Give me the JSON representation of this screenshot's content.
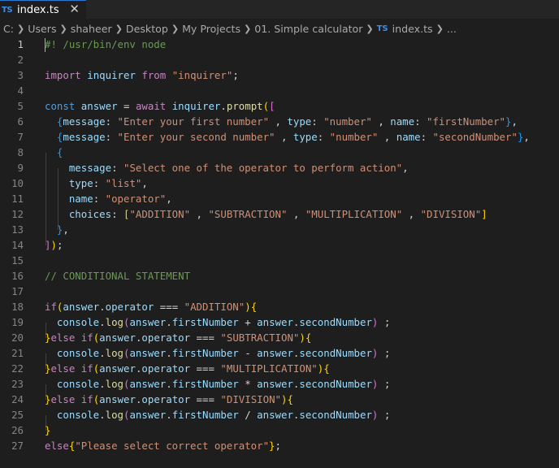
{
  "tab": {
    "badge": "TS",
    "label": "index.ts",
    "close": "✕"
  },
  "breadcrumb": {
    "items": [
      "C:",
      "Users",
      "shaheer",
      "Desktop",
      "My Projects",
      "01. Simple calculator"
    ],
    "file_badge": "TS",
    "file": "index.ts",
    "more": "..."
  },
  "editor": {
    "active_line": 1,
    "lines": [
      [
        [
          "cmt",
          "#! /usr/bin/env node"
        ]
      ],
      [],
      [
        [
          "ctl",
          "import"
        ],
        [
          "txt",
          " "
        ],
        [
          "var",
          "inquirer"
        ],
        [
          "txt",
          " "
        ],
        [
          "ctl",
          "from"
        ],
        [
          "txt",
          " "
        ],
        [
          "str",
          "\"inquirer\""
        ],
        [
          "txt",
          ";"
        ]
      ],
      [],
      [
        [
          "kw",
          "const"
        ],
        [
          "txt",
          " "
        ],
        [
          "var",
          "answer"
        ],
        [
          "txt",
          " = "
        ],
        [
          "ctl",
          "await"
        ],
        [
          "txt",
          " "
        ],
        [
          "var",
          "inquirer"
        ],
        [
          "txt",
          "."
        ],
        [
          "fn",
          "prompt"
        ],
        [
          "b1",
          "("
        ],
        [
          "b2",
          "["
        ]
      ],
      [
        [
          "txt",
          "  "
        ],
        [
          "b3",
          "{"
        ],
        [
          "var",
          "message"
        ],
        [
          "txt",
          ": "
        ],
        [
          "str",
          "\"Enter your first number\""
        ],
        [
          "txt",
          " , "
        ],
        [
          "var",
          "type"
        ],
        [
          "txt",
          ": "
        ],
        [
          "str",
          "\"number\""
        ],
        [
          "txt",
          " , "
        ],
        [
          "var",
          "name"
        ],
        [
          "txt",
          ": "
        ],
        [
          "str",
          "\"firstNumber\""
        ],
        [
          "b3",
          "}"
        ],
        [
          "txt",
          ","
        ]
      ],
      [
        [
          "txt",
          "  "
        ],
        [
          "b3",
          "{"
        ],
        [
          "var",
          "message"
        ],
        [
          "txt",
          ": "
        ],
        [
          "str",
          "\"Enter your second number\""
        ],
        [
          "txt",
          " , "
        ],
        [
          "var",
          "type"
        ],
        [
          "txt",
          ": "
        ],
        [
          "str",
          "\"number\""
        ],
        [
          "txt",
          " , "
        ],
        [
          "var",
          "name"
        ],
        [
          "txt",
          ": "
        ],
        [
          "str",
          "\"secondNumber\""
        ],
        [
          "b3",
          "}"
        ],
        [
          "txt",
          ","
        ]
      ],
      [
        [
          "txt",
          "  "
        ],
        [
          "b3",
          "{"
        ]
      ],
      [
        [
          "txt",
          "    "
        ],
        [
          "var",
          "message"
        ],
        [
          "txt",
          ": "
        ],
        [
          "str",
          "\"Select one of the operator to perform action\""
        ],
        [
          "txt",
          ","
        ]
      ],
      [
        [
          "txt",
          "    "
        ],
        [
          "var",
          "type"
        ],
        [
          "txt",
          ": "
        ],
        [
          "str",
          "\"list\""
        ],
        [
          "txt",
          ","
        ]
      ],
      [
        [
          "txt",
          "    "
        ],
        [
          "var",
          "name"
        ],
        [
          "txt",
          ": "
        ],
        [
          "str",
          "\"operator\""
        ],
        [
          "txt",
          ","
        ]
      ],
      [
        [
          "txt",
          "    "
        ],
        [
          "var",
          "choices"
        ],
        [
          "txt",
          ": "
        ],
        [
          "b1",
          "["
        ],
        [
          "str",
          "\"ADDITION\""
        ],
        [
          "txt",
          " , "
        ],
        [
          "str",
          "\"SUBTRACTION\""
        ],
        [
          "txt",
          " , "
        ],
        [
          "str",
          "\"MULTIPLICATION\""
        ],
        [
          "txt",
          " , "
        ],
        [
          "str",
          "\"DIVISION\""
        ],
        [
          "b1",
          "]"
        ]
      ],
      [
        [
          "txt",
          "  "
        ],
        [
          "b3",
          "}"
        ],
        [
          "txt",
          ","
        ]
      ],
      [
        [
          "b2",
          "]"
        ],
        [
          "b1",
          ")"
        ],
        [
          "txt",
          ";"
        ]
      ],
      [],
      [
        [
          "cmt",
          "// CONDITIONAL STATEMENT"
        ]
      ],
      [],
      [
        [
          "ctl",
          "if"
        ],
        [
          "b1",
          "("
        ],
        [
          "var",
          "answer"
        ],
        [
          "txt",
          "."
        ],
        [
          "var",
          "operator"
        ],
        [
          "txt",
          " === "
        ],
        [
          "str",
          "\"ADDITION\""
        ],
        [
          "b1",
          ")"
        ],
        [
          "b1",
          "{"
        ]
      ],
      [
        [
          "txt",
          "  "
        ],
        [
          "var",
          "console"
        ],
        [
          "txt",
          "."
        ],
        [
          "fn",
          "log"
        ],
        [
          "b2",
          "("
        ],
        [
          "var",
          "answer"
        ],
        [
          "txt",
          "."
        ],
        [
          "var",
          "firstNumber"
        ],
        [
          "txt",
          " + "
        ],
        [
          "var",
          "answer"
        ],
        [
          "txt",
          "."
        ],
        [
          "var",
          "secondNumber"
        ],
        [
          "b2",
          ")"
        ],
        [
          "txt",
          " ;"
        ]
      ],
      [
        [
          "b1",
          "}"
        ],
        [
          "ctl",
          "else"
        ],
        [
          "txt",
          " "
        ],
        [
          "ctl",
          "if"
        ],
        [
          "b1",
          "("
        ],
        [
          "var",
          "answer"
        ],
        [
          "txt",
          "."
        ],
        [
          "var",
          "operator"
        ],
        [
          "txt",
          " === "
        ],
        [
          "str",
          "\"SUBTRACTION\""
        ],
        [
          "b1",
          ")"
        ],
        [
          "b1",
          "{"
        ]
      ],
      [
        [
          "txt",
          "  "
        ],
        [
          "var",
          "console"
        ],
        [
          "txt",
          "."
        ],
        [
          "fn",
          "log"
        ],
        [
          "b2",
          "("
        ],
        [
          "var",
          "answer"
        ],
        [
          "txt",
          "."
        ],
        [
          "var",
          "firstNumber"
        ],
        [
          "txt",
          " - "
        ],
        [
          "var",
          "answer"
        ],
        [
          "txt",
          "."
        ],
        [
          "var",
          "secondNumber"
        ],
        [
          "b2",
          ")"
        ],
        [
          "txt",
          " ;"
        ]
      ],
      [
        [
          "b1",
          "}"
        ],
        [
          "ctl",
          "else"
        ],
        [
          "txt",
          " "
        ],
        [
          "ctl",
          "if"
        ],
        [
          "b1",
          "("
        ],
        [
          "var",
          "answer"
        ],
        [
          "txt",
          "."
        ],
        [
          "var",
          "operator"
        ],
        [
          "txt",
          " === "
        ],
        [
          "str",
          "\"MULTIPLICATION\""
        ],
        [
          "b1",
          ")"
        ],
        [
          "b1",
          "{"
        ]
      ],
      [
        [
          "txt",
          "  "
        ],
        [
          "var",
          "console"
        ],
        [
          "txt",
          "."
        ],
        [
          "fn",
          "log"
        ],
        [
          "b2",
          "("
        ],
        [
          "var",
          "answer"
        ],
        [
          "txt",
          "."
        ],
        [
          "var",
          "firstNumber"
        ],
        [
          "txt",
          " * "
        ],
        [
          "var",
          "answer"
        ],
        [
          "txt",
          "."
        ],
        [
          "var",
          "secondNumber"
        ],
        [
          "b2",
          ")"
        ],
        [
          "txt",
          " ;"
        ]
      ],
      [
        [
          "b1",
          "}"
        ],
        [
          "ctl",
          "else"
        ],
        [
          "txt",
          " "
        ],
        [
          "ctl",
          "if"
        ],
        [
          "b1",
          "("
        ],
        [
          "var",
          "answer"
        ],
        [
          "txt",
          "."
        ],
        [
          "var",
          "operator"
        ],
        [
          "txt",
          " === "
        ],
        [
          "str",
          "\"DIVISION\""
        ],
        [
          "b1",
          ")"
        ],
        [
          "b1",
          "{"
        ]
      ],
      [
        [
          "txt",
          "  "
        ],
        [
          "var",
          "console"
        ],
        [
          "txt",
          "."
        ],
        [
          "fn",
          "log"
        ],
        [
          "b2",
          "("
        ],
        [
          "var",
          "answer"
        ],
        [
          "txt",
          "."
        ],
        [
          "var",
          "firstNumber"
        ],
        [
          "txt",
          " / "
        ],
        [
          "var",
          "answer"
        ],
        [
          "txt",
          "."
        ],
        [
          "var",
          "secondNumber"
        ],
        [
          "b2",
          ")"
        ],
        [
          "txt",
          " ;"
        ]
      ],
      [
        [
          "b1",
          "}"
        ]
      ],
      [
        [
          "ctl",
          "else"
        ],
        [
          "b1",
          "{"
        ],
        [
          "str",
          "\"Please select correct operator\""
        ],
        [
          "b1",
          "}"
        ],
        [
          "txt",
          ";"
        ]
      ]
    ]
  },
  "colors": {
    "background": "#1e1e1e",
    "keyword": "#569cd6",
    "control": "#c586c0",
    "variable": "#9cdcfe",
    "function": "#dcdcaa",
    "string": "#ce9178",
    "comment": "#6a9955",
    "bracket_1": "#ffd700",
    "bracket_2": "#da70d6",
    "bracket_3": "#179fff"
  }
}
